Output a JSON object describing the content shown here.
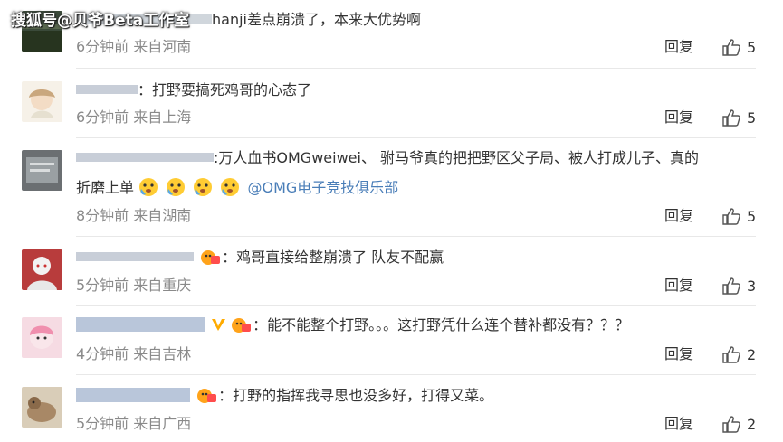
{
  "watermark": "搜狐号@贝爷Beta工作室",
  "reply_label": "回复",
  "comments": [
    {
      "text": "hanji差点崩溃了，本来大优势啊",
      "meta": "6分钟前 来自河南",
      "likes": "5"
    },
    {
      "text": "：打野要搞死鸡哥的心态了",
      "meta": "6分钟前 来自上海",
      "likes": "5"
    },
    {
      "text": ":万人血书OMGweiwei、 驸马爷真的把把野区父子局、被人打成儿子、真的",
      "text2": "折磨上单",
      "mention": "@OMG电子竞技俱乐部",
      "meta": "8分钟前 来自湖南",
      "likes": "5"
    },
    {
      "text": "：鸡哥直接给整崩溃了 队友不配赢",
      "meta": "5分钟前 来自重庆",
      "likes": "3"
    },
    {
      "text": "：能不能整个打野。。。这打野凭什么连个替补都没有？？？",
      "meta": "4分钟前 来自吉林",
      "likes": "2"
    },
    {
      "text": "：打野的指挥我寻思也没多好，打得又菜。",
      "meta": "5分钟前 来自广西",
      "likes": "2"
    }
  ],
  "colors": {
    "mention": "#4a7eb8",
    "meta": "#8a8a8a",
    "divider": "#e8e8e8"
  }
}
